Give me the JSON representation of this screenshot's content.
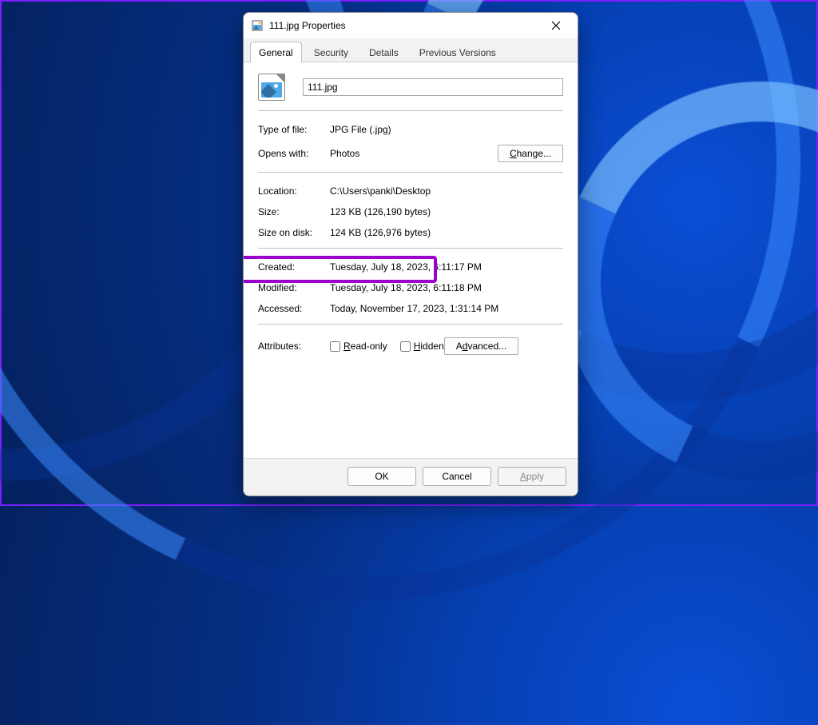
{
  "window": {
    "title": "111.jpg Properties"
  },
  "tabs": {
    "general": "General",
    "security": "Security",
    "details": "Details",
    "previous_versions": "Previous Versions"
  },
  "file": {
    "name": "111.jpg"
  },
  "props": {
    "type_of_file_label": "Type of file:",
    "type_of_file_value": "JPG File (.jpg)",
    "opens_with_label": "Opens with:",
    "opens_with_value": "Photos",
    "change_button": "Change...",
    "location_label": "Location:",
    "location_value": "C:\\Users\\panki\\Desktop",
    "size_label": "Size:",
    "size_value": "123 KB (126,190 bytes)",
    "size_on_disk_label": "Size on disk:",
    "size_on_disk_value": "124 KB (126,976 bytes)",
    "created_label": "Created:",
    "created_value": "Tuesday, July 18, 2023, 6:11:17 PM",
    "modified_label": "Modified:",
    "modified_value": "Tuesday, July 18, 2023, 6:11:18 PM",
    "accessed_label": "Accessed:",
    "accessed_value": "Today, November 17, 2023, 1:31:14 PM",
    "attributes_label": "Attributes:",
    "readonly_label": "Read-only",
    "hidden_label": "Hidden",
    "advanced_button": "Advanced..."
  },
  "footer_buttons": {
    "ok": "OK",
    "cancel": "Cancel",
    "apply": "Apply"
  },
  "colors": {
    "highlight": "#9b00cc"
  }
}
